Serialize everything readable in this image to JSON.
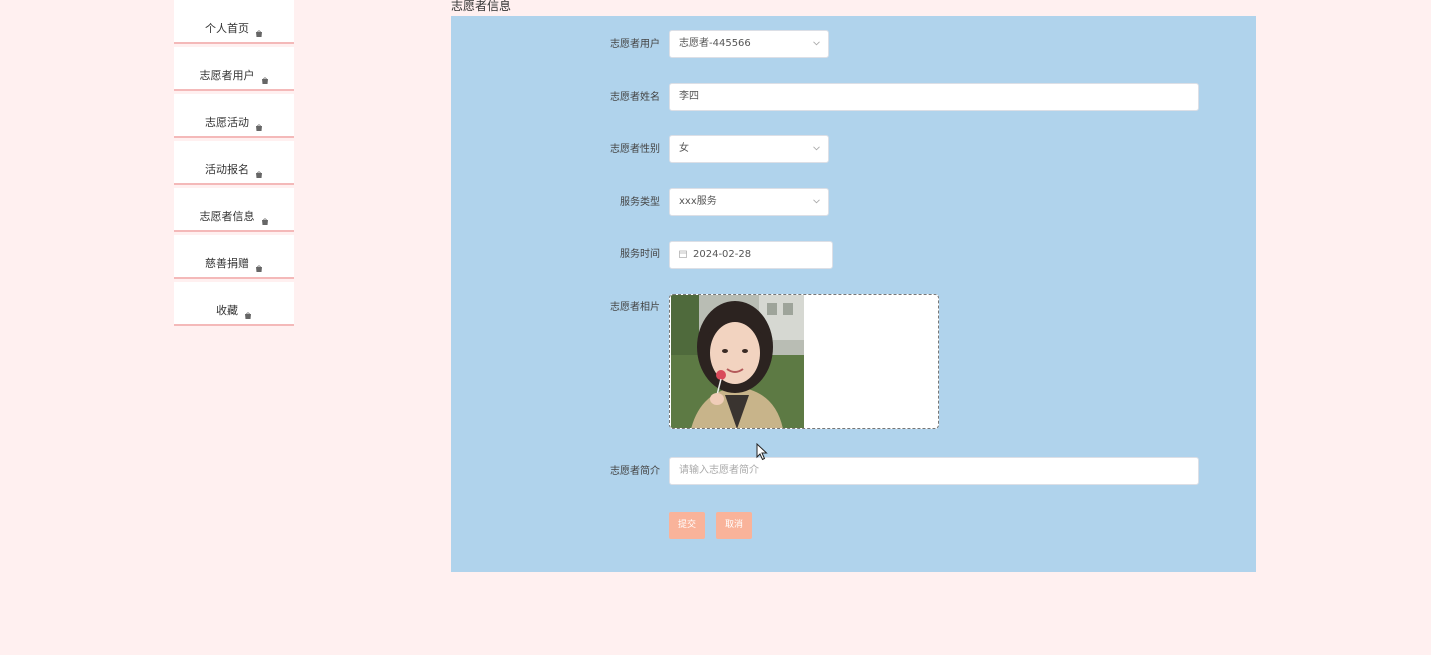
{
  "sidebar": {
    "items": [
      {
        "label": "个人首页",
        "icon": "bag-icon"
      },
      {
        "label": "志愿者用户",
        "icon": "bag-icon"
      },
      {
        "label": "志愿活动",
        "icon": "bag-icon"
      },
      {
        "label": "活动报名",
        "icon": "bag-icon"
      },
      {
        "label": "志愿者信息",
        "icon": "bag-icon"
      },
      {
        "label": "慈善捐赠",
        "icon": "bag-icon"
      },
      {
        "label": "收藏",
        "icon": "bag-icon"
      }
    ]
  },
  "page": {
    "title": "志愿者信息"
  },
  "form": {
    "user": {
      "label": "志愿者用户",
      "value": "志愿者-445566"
    },
    "name": {
      "label": "志愿者姓名",
      "value": "李四"
    },
    "gender": {
      "label": "志愿者性别",
      "value": "女"
    },
    "service_type": {
      "label": "服务类型",
      "value": "xxx服务"
    },
    "service_time": {
      "label": "服务时间",
      "value": "2024-02-28"
    },
    "photo": {
      "label": "志愿者相片"
    },
    "intro": {
      "label": "志愿者简介",
      "value": "",
      "placeholder": "请输入志愿者简介"
    },
    "submit_label": "提交",
    "cancel_label": "取消"
  },
  "colors": {
    "page_bg": "#fff0f0",
    "panel_bg": "#b0d3ec",
    "button_bg": "#f9b39a",
    "sidebar_border": "#f4b9b9"
  }
}
